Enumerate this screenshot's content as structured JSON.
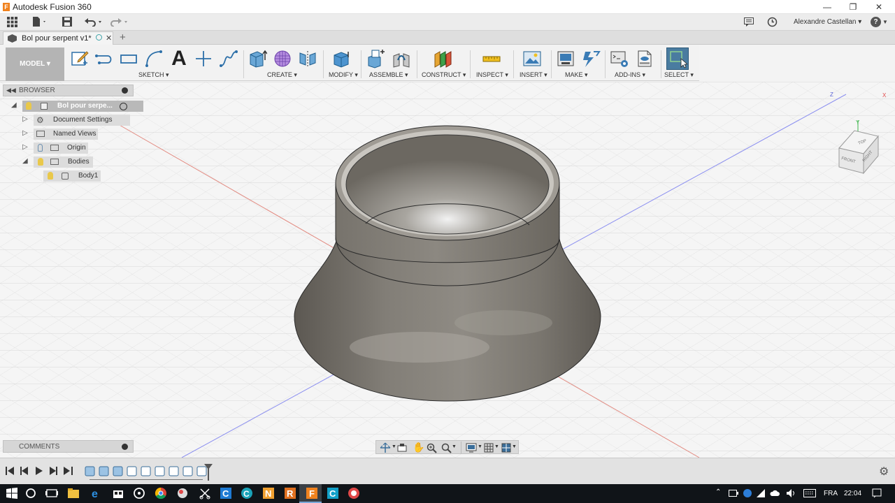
{
  "window": {
    "title": "Autodesk Fusion 360",
    "controls": [
      "minimize",
      "restore",
      "close"
    ]
  },
  "quick_access": {
    "icons": [
      "grid-icon",
      "file-icon",
      "save-icon",
      "undo-icon",
      "redo-icon"
    ],
    "user_name": "Alexandre Castellan ▾",
    "help": "?"
  },
  "document_tab": {
    "title": "Bol pour serpent v1*",
    "close": "✕",
    "add": "+"
  },
  "toolbar": {
    "workspace": "MODEL ▾",
    "groups": [
      {
        "label": "SKETCH ▾"
      },
      {
        "label": "CREATE ▾"
      },
      {
        "label": "MODIFY ▾"
      },
      {
        "label": "ASSEMBLE ▾"
      },
      {
        "label": "CONSTRUCT ▾"
      },
      {
        "label": "INSPECT ▾"
      },
      {
        "label": "INSERT ▾"
      },
      {
        "label": "MAKE ▾"
      },
      {
        "label": "ADD-INS ▾"
      },
      {
        "label": "SELECT ▾"
      }
    ],
    "sketch_text_tool": "A"
  },
  "browser": {
    "header": "BROWSER",
    "root": "Bol pour serpe...",
    "items": [
      {
        "label": "Document Settings"
      },
      {
        "label": "Named Views"
      },
      {
        "label": "Origin"
      },
      {
        "label": "Bodies"
      },
      {
        "label": "Body1"
      }
    ]
  },
  "viewcube": {
    "top": "TOP",
    "front": "FRONT",
    "right": "RIGHT",
    "axis_y": "Y",
    "axis_z": "Z",
    "axis_x": "X"
  },
  "comments": {
    "header": "COMMENTS"
  },
  "taskbar": {
    "language": "FRA",
    "time": "22:04"
  },
  "colors": {
    "toolbar_bg": "#f2f2f2",
    "canvas_bg": "#f4f4f4",
    "model_body": "#6f6b64",
    "select_accent": "#4a7ca0",
    "taskbar_bg": "#101418"
  }
}
